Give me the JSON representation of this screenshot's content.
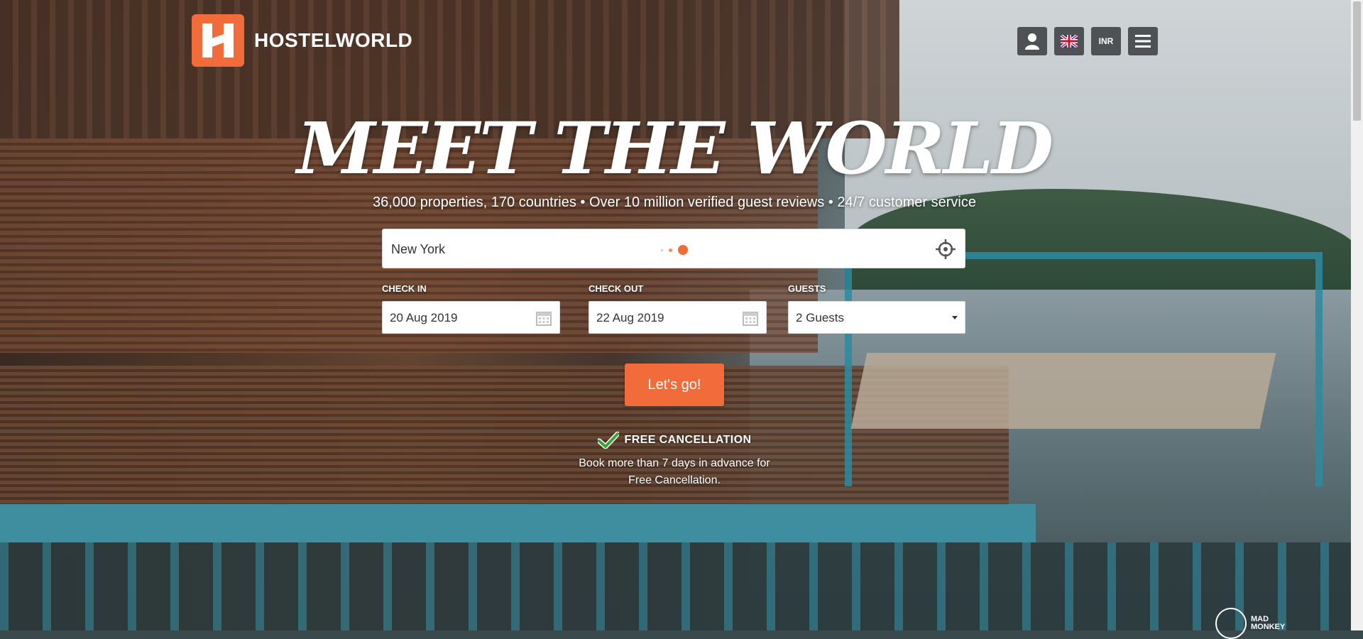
{
  "header": {
    "brand": "HOSTELWORLD",
    "account_icon": "user-icon",
    "language_icon": "uk-flag-icon",
    "currency_label": "INR",
    "menu_icon": "hamburger-menu-icon"
  },
  "hero": {
    "title": "MEET THE WORLD",
    "tagline": "36,000 properties, 170 countries • Over 10 million verified guest reviews • 24/7 customer service"
  },
  "search": {
    "destination_value": "New York",
    "locate_icon": "crosshair-icon",
    "check_in_label": "CHECK IN",
    "check_in_value": "20 Aug 2019",
    "check_out_label": "CHECK OUT",
    "check_out_value": "22 Aug 2019",
    "guests_label": "GUESTS",
    "guests_value": "2 Guests",
    "submit_label": "Let's go!"
  },
  "free_cancellation": {
    "title": "FREE CANCELLATION",
    "body": "Book more than 7 days in advance for Free Cancellation."
  },
  "partner": {
    "label_line1": "MAD",
    "label_line2": "MONKEY"
  },
  "colors": {
    "brand_orange": "#f26b3a",
    "header_button_bg": "#4f5254",
    "check_green": "#3aa335"
  }
}
